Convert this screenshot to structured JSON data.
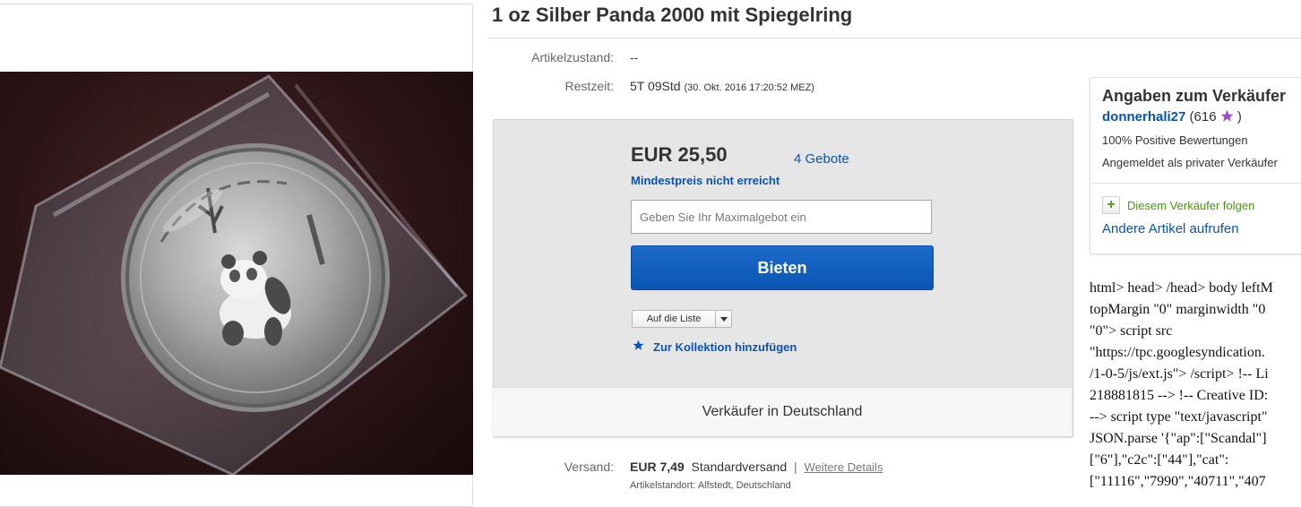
{
  "title": "1 oz Silber Panda 2000 mit Spiegelring",
  "details": {
    "condition_label": "Artikelzustand:",
    "condition_value": "--",
    "time_label": "Restzeit:",
    "time_value": "5T 09Std",
    "time_end": "(30. Okt. 2016 17:20:52 MEZ)"
  },
  "bid": {
    "price": "EUR 25,50",
    "bids_count": "4 Gebote",
    "reserve_note": "Mindestpreis nicht erreicht",
    "input_placeholder": "Geben Sie Ihr Maximalgebot ein",
    "button_label": "Bieten",
    "watch_label": "Auf die Liste",
    "collection_label": "Zur Kollektion hinzufügen",
    "seller_location_note": "Verkäufer in Deutschland"
  },
  "shipping": {
    "label": "Versand:",
    "price": "EUR 7,49",
    "method": "Standardversand",
    "separator": "|",
    "details_link": "Weitere Details",
    "location": "Artikelstandort: Alfstedt, Deutschland"
  },
  "seller": {
    "heading": "Angaben zum Verkäufer",
    "username": "donnerhali27",
    "feedback_count": "616",
    "positive": "100% Positive Bewertungen",
    "account_type": "Angemeldet als privater Verkäufer",
    "follow_label": "Diesem Verkäufer folgen",
    "other_items": "Andere Artikel aufrufen"
  },
  "raw_code_lines": [
    "html> head> /head> body leftM",
    "topMargin \"0\" marginwidth \"0",
    "\"0\"> script src",
    "\"https://tpc.googlesyndication.",
    "/1-0-5/js/ext.js\"> /script> !-- Li",
    "218881815 --> !-- Creative ID:",
    "--> script type \"text/javascript\"",
    "JSON.parse '{\"ap\":[\"Scandal\"]",
    "[\"6\"],\"c2c\":[\"44\"],\"cat\":",
    "[\"11116\",\"7990\",\"40711\",\"407"
  ],
  "colors": {
    "link": "#0654ba",
    "bid_button": "#0b56b3",
    "follow_green": "#459909",
    "star": "#9a4fc4"
  }
}
